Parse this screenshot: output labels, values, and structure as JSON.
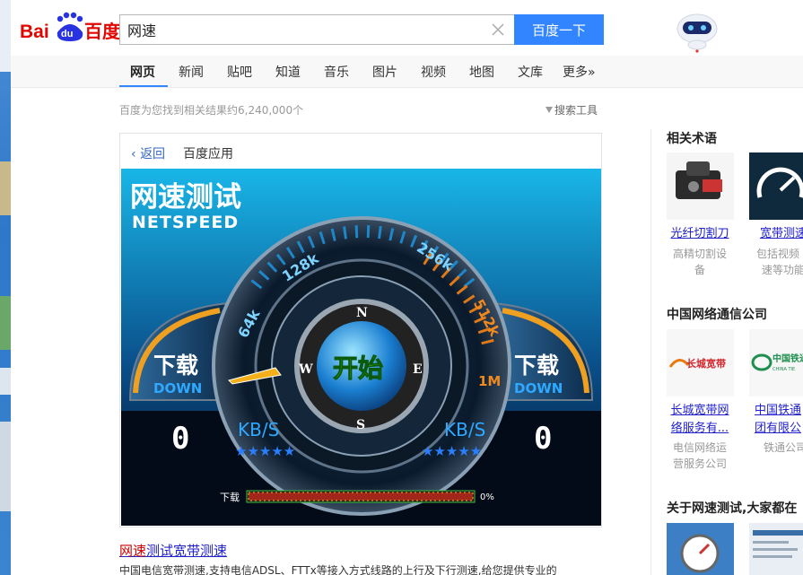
{
  "header": {
    "logo_text_latin": "Bai",
    "logo_text_du": "du",
    "logo_text_cn": "百度",
    "search_value": "网速",
    "search_button": "百度一下"
  },
  "nav": {
    "items": [
      "网页",
      "新闻",
      "贴吧",
      "知道",
      "音乐",
      "图片",
      "视频",
      "地图",
      "文库",
      "更多»"
    ]
  },
  "results": {
    "count_text": "百度为您找到相关结果约6,240,000个",
    "tools_label": "搜索工具"
  },
  "app_card": {
    "back_label": "返回",
    "title": "百度应用",
    "widget": {
      "title_cn": "网速测试",
      "title_en": "NETSPEED",
      "dial_labels": [
        "64k",
        "128k",
        "256k",
        "512k",
        "1M"
      ],
      "compass": [
        "N",
        "S",
        "E",
        "W"
      ],
      "start_label": "开始",
      "left_label_cn": "下载",
      "left_label_en": "DOWN",
      "right_label_cn": "下载",
      "right_label_en": "DOWN",
      "left_value": "0",
      "right_value": "0",
      "unit_left": "KB/S",
      "unit_right": "KB/S",
      "stars": "★★★★★",
      "progress_label": "下载",
      "progress_value": 0,
      "progress_text": "0%"
    }
  },
  "result": {
    "title_highlight": "网速",
    "title_rest": "测试宽带测速",
    "description": "中国电信宽带测速,支持电信ADSL、FTTx等接入方式线路的上行及下行测速,给您提供专业的"
  },
  "sidebar": {
    "section1_title": "相关术语",
    "section1_items": [
      {
        "name": "光纤切割刀",
        "sub": [
          "高精切割设",
          "备"
        ]
      },
      {
        "name": "宽带测速",
        "sub": [
          "包括视频",
          "速等功能"
        ]
      }
    ],
    "section2_title": "中国网络通信公司",
    "section2_items": [
      {
        "name_lines": [
          "长城宽带网",
          "络服务有..."
        ],
        "sub": [
          "电信网络运",
          "营服务公司"
        ],
        "logo_text": "长城宽带"
      },
      {
        "name_lines": [
          "中国铁通",
          "团有限公"
        ],
        "sub": [
          "铁通公司"
        ],
        "logo_cn": "中国铁通",
        "logo_en": "CHINA TIE"
      }
    ],
    "section3_title": "关于网速测试,大家都在"
  },
  "colors": {
    "accent": "#3385ff",
    "link": "#2222cc",
    "highlight": "#cc0000"
  }
}
